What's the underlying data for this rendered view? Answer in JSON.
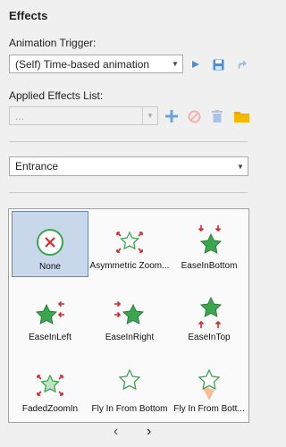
{
  "title": "Effects",
  "trigger": {
    "label": "Animation Trigger:",
    "value": "(Self) Time-based animation"
  },
  "applied": {
    "label": "Applied Effects List:",
    "value": "..."
  },
  "category": {
    "value": "Entrance"
  },
  "effects": [
    {
      "name": "None"
    },
    {
      "name": "Asymmetric Zoom..."
    },
    {
      "name": "EaseInBottom"
    },
    {
      "name": "EaseInLeft"
    },
    {
      "name": "EaseInRight"
    },
    {
      "name": "EaseInTop"
    },
    {
      "name": "FadedZoomIn"
    },
    {
      "name": "Fly In  From Bottom"
    },
    {
      "name": "Fly In  From Bott..."
    }
  ],
  "colors": {
    "star": "#3aa64e",
    "arrow": "#d8262d",
    "accent": "#4a90d9",
    "folder": "#f0a800"
  },
  "icons": {
    "play": "play-icon",
    "save": "save-icon",
    "redo": "redo-icon",
    "add": "add-icon",
    "block": "block-icon",
    "delete": "delete-icon",
    "folder": "folder-icon",
    "prev": "chevron-left-icon",
    "next": "chevron-right-icon"
  }
}
